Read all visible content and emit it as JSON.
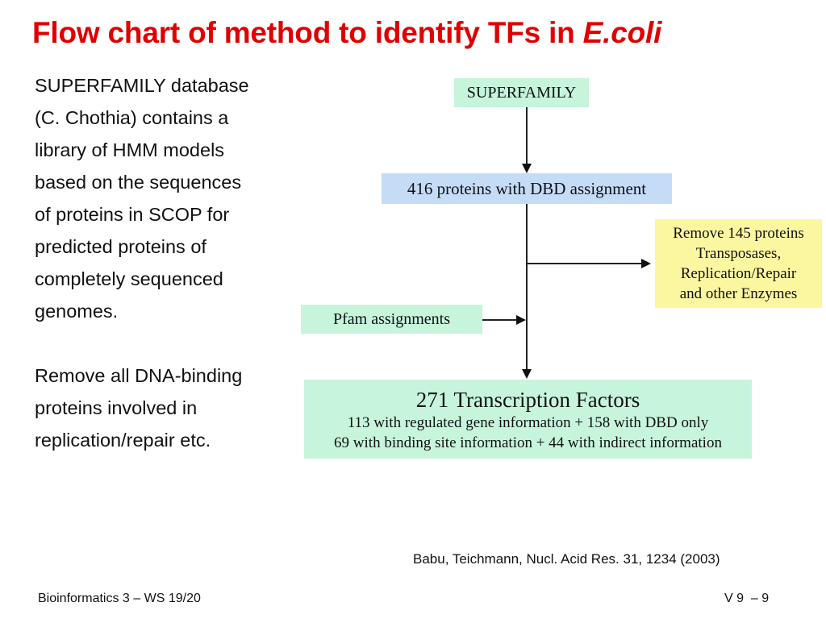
{
  "slide": {
    "title_main": "Flow chart of method to identify TFs in ",
    "title_italic": "E.coli",
    "left_paragraphs": [
      {
        "lines": [
          "SUPERFAMILY database",
          "(C. Chothia) contains a",
          "library of HMM models",
          "based on the sequences",
          "of proteins in SCOP for",
          "predicted proteins of",
          "completely sequenced",
          "genomes."
        ]
      },
      {
        "lines": [
          "Remove all DNA-binding",
          "proteins involved in",
          "replication/repair etc."
        ]
      }
    ],
    "flowchart": {
      "superfamily": "SUPERFAMILY",
      "dbd_assignment": "416 proteins with DBD assignment",
      "remove_box": [
        "Remove 145 proteins",
        "Transposases,",
        "Replication/Repair",
        "and other Enzymes"
      ],
      "pfam": "Pfam assignments",
      "result_title": "271 Transcription Factors",
      "result_lines": [
        "113 with regulated gene information + 158 with DBD only",
        "69 with binding site information + 44 with indirect information"
      ]
    },
    "citation": "Babu, Teichmann, Nucl. Acid Res. 31, 1234 (2003)",
    "footer_left": "Bioinformatics 3 – WS 19/20",
    "footer_right": "V 9  – 9"
  }
}
